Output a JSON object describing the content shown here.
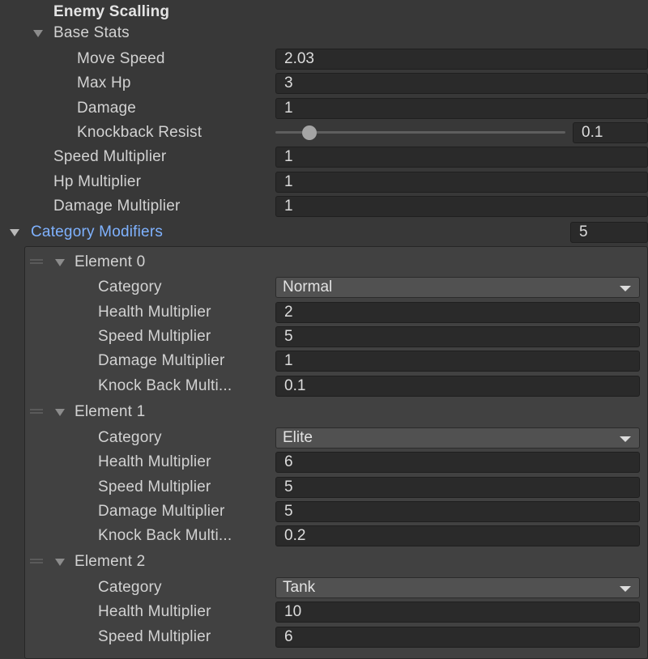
{
  "header": {
    "title": "Enemy Scalling"
  },
  "base_stats": {
    "label": "Base Stats",
    "move_speed": {
      "label": "Move Speed",
      "value": "2.03"
    },
    "max_hp": {
      "label": "Max Hp",
      "value": "3"
    },
    "damage": {
      "label": "Damage",
      "value": "1"
    },
    "knockback_resist": {
      "label": "Knockback Resist",
      "value": "0.1",
      "slider_fraction": 0.1
    }
  },
  "multipliers": {
    "speed": {
      "label": "Speed Multiplier",
      "value": "1"
    },
    "hp": {
      "label": "Hp Multiplier",
      "value": "1"
    },
    "damage": {
      "label": "Damage Multiplier",
      "value": "1"
    }
  },
  "category_modifiers": {
    "label": "Category Modifiers",
    "count": "5",
    "elements": [
      {
        "title": "Element 0",
        "category": {
          "label": "Category",
          "value": "Normal"
        },
        "health": {
          "label": "Health Multiplier",
          "value": "2"
        },
        "speed": {
          "label": "Speed Multiplier",
          "value": "5"
        },
        "damage": {
          "label": "Damage Multiplier",
          "value": "1"
        },
        "knockback": {
          "label": "Knock Back Multi...",
          "value": "0.1"
        }
      },
      {
        "title": "Element 1",
        "category": {
          "label": "Category",
          "value": "Elite"
        },
        "health": {
          "label": "Health Multiplier",
          "value": "6"
        },
        "speed": {
          "label": "Speed Multiplier",
          "value": "5"
        },
        "damage": {
          "label": "Damage Multiplier",
          "value": "5"
        },
        "knockback": {
          "label": "Knock Back Multi...",
          "value": "0.2"
        }
      },
      {
        "title": "Element 2",
        "category": {
          "label": "Category",
          "value": "Tank"
        },
        "health": {
          "label": "Health Multiplier",
          "value": "10"
        },
        "speed": {
          "label": "Speed Multiplier",
          "value": "6"
        }
      }
    ]
  },
  "colors": {
    "background": "#383838",
    "field": "#2a2a2a",
    "accent_label": "#7fb2ff",
    "dropdown": "#515151"
  },
  "icons": [
    "foldout-arrow-icon",
    "drag-handle-icon",
    "dropdown-arrow-icon",
    "slider-thumb-icon"
  ]
}
